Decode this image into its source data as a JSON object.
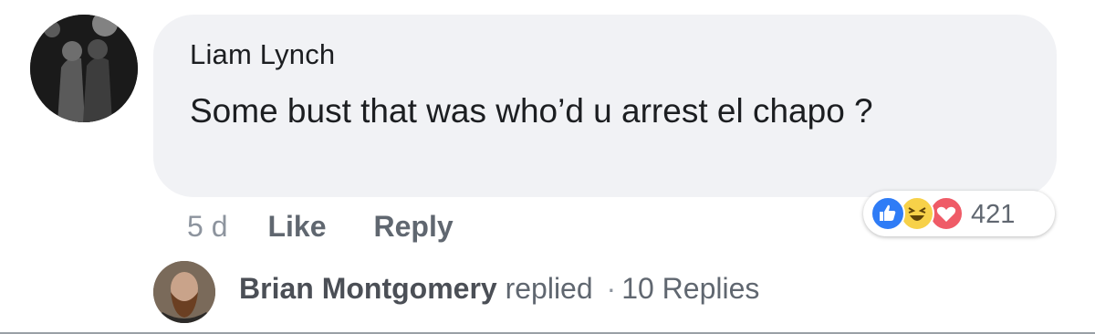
{
  "comment": {
    "author": "Liam Lynch",
    "text": "Some bust that was who’d u arrest el chapo ?",
    "timestamp": "5 d",
    "like_label": "Like",
    "reply_label": "Reply"
  },
  "reactions": {
    "icons": [
      "like-icon",
      "haha-icon",
      "love-icon"
    ],
    "count": "421",
    "colors": {
      "like": "#2f7cf6",
      "haha": "#f7d149",
      "love": "#ef5b67"
    }
  },
  "reply_summary": {
    "name": "Brian Montgomery",
    "verb": "replied",
    "separator": "·",
    "replies": "10 Replies"
  },
  "colors": {
    "bubble": "#f1f2f5",
    "text": "#1c1e21",
    "secondary": "#606770"
  }
}
